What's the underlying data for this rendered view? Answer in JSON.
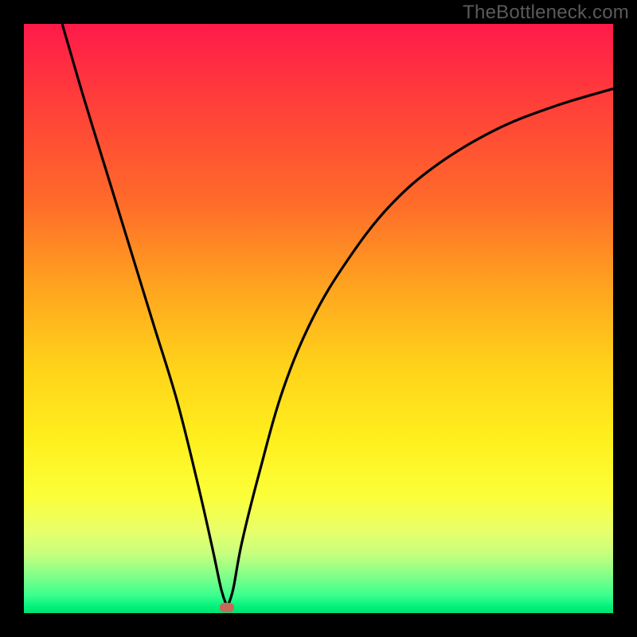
{
  "watermark": "TheBottleneck.com",
  "chart_data": {
    "type": "line",
    "title": "",
    "xlabel": "",
    "ylabel": "",
    "xlim": [
      0,
      1
    ],
    "ylim": [
      0,
      1
    ],
    "marker": {
      "x": 0.345,
      "y": 0.01
    },
    "series": [
      {
        "name": "curve",
        "x": [
          0.065,
          0.1,
          0.14,
          0.18,
          0.22,
          0.26,
          0.295,
          0.32,
          0.335,
          0.345,
          0.355,
          0.37,
          0.4,
          0.44,
          0.49,
          0.55,
          0.62,
          0.7,
          0.8,
          0.9,
          1.0
        ],
        "y": [
          1.0,
          0.88,
          0.75,
          0.62,
          0.49,
          0.36,
          0.22,
          0.11,
          0.04,
          0.01,
          0.04,
          0.12,
          0.24,
          0.38,
          0.5,
          0.6,
          0.69,
          0.76,
          0.82,
          0.86,
          0.89
        ]
      }
    ],
    "colors": {
      "curve": "#000000",
      "marker": "#c56a5a",
      "background_top": "#ff1a4a",
      "background_bottom": "#00e070",
      "frame": "#000000"
    }
  }
}
